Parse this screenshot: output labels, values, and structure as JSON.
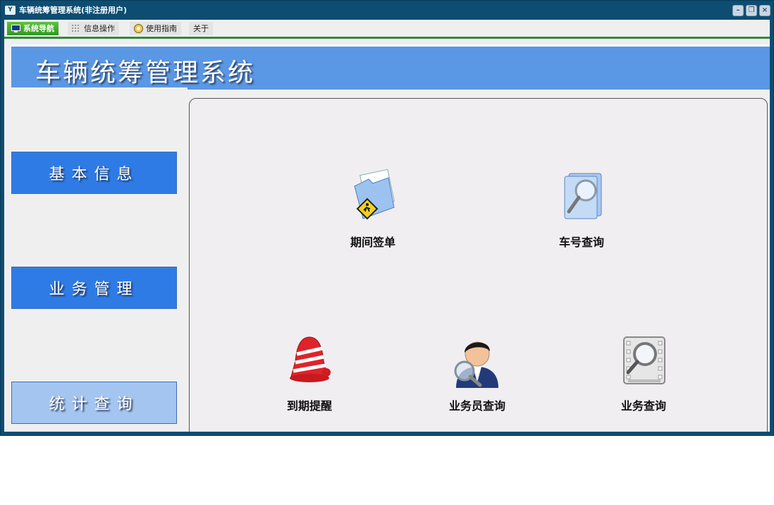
{
  "window": {
    "title": "车辆统筹管理系统(非注册用户)",
    "app_icon": "Y"
  },
  "menu": [
    {
      "label": "系统导航",
      "icon": "monitor-icon",
      "active": true
    },
    {
      "label": "信息操作",
      "icon": "grid-icon",
      "active": false
    },
    {
      "label": "使用指南",
      "icon": "help-icon",
      "active": false
    },
    {
      "label": "关于",
      "icon": "",
      "active": false
    }
  ],
  "banner": {
    "title": "车辆统筹管理系统"
  },
  "nav": [
    {
      "label": "基本信息"
    },
    {
      "label": "业务管理"
    },
    {
      "label": "统计查询"
    }
  ],
  "tiles": [
    {
      "label": "期间签单",
      "icon": "folder-pedestrian-icon"
    },
    {
      "label": "车号查询",
      "icon": "document-search-icon"
    },
    {
      "label": "到期提醒",
      "icon": "alarm-bell-icon"
    },
    {
      "label": "业务员查询",
      "icon": "person-search-icon"
    },
    {
      "label": "业务查询",
      "icon": "film-search-icon"
    }
  ],
  "colors": {
    "titlebar": "#0d4d72",
    "banner": "#5a97e4",
    "nav_dark": "#2f7be6",
    "nav_light": "#a4c5f0",
    "menu_active": "#3fa82a"
  }
}
